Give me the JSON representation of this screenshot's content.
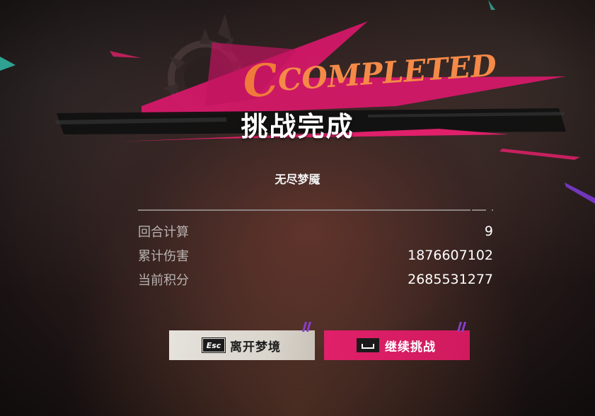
{
  "banner": {
    "word": "COMPLETED",
    "title": "挑战完成"
  },
  "mode": {
    "name": "无尽梦魇"
  },
  "stats": [
    {
      "label": "回合计算",
      "value": "9"
    },
    {
      "label": "累计伤害",
      "value": "1876607102"
    },
    {
      "label": "当前积分",
      "value": "2685531277"
    }
  ],
  "buttons": {
    "leave": {
      "key": "Esc",
      "label": "离开梦境"
    },
    "continue": {
      "label": "继续挑战"
    }
  },
  "colors": {
    "accent": "#e0206a",
    "completed_orange": "#f07a3a",
    "stripe_purple": "#8a3fd0"
  }
}
